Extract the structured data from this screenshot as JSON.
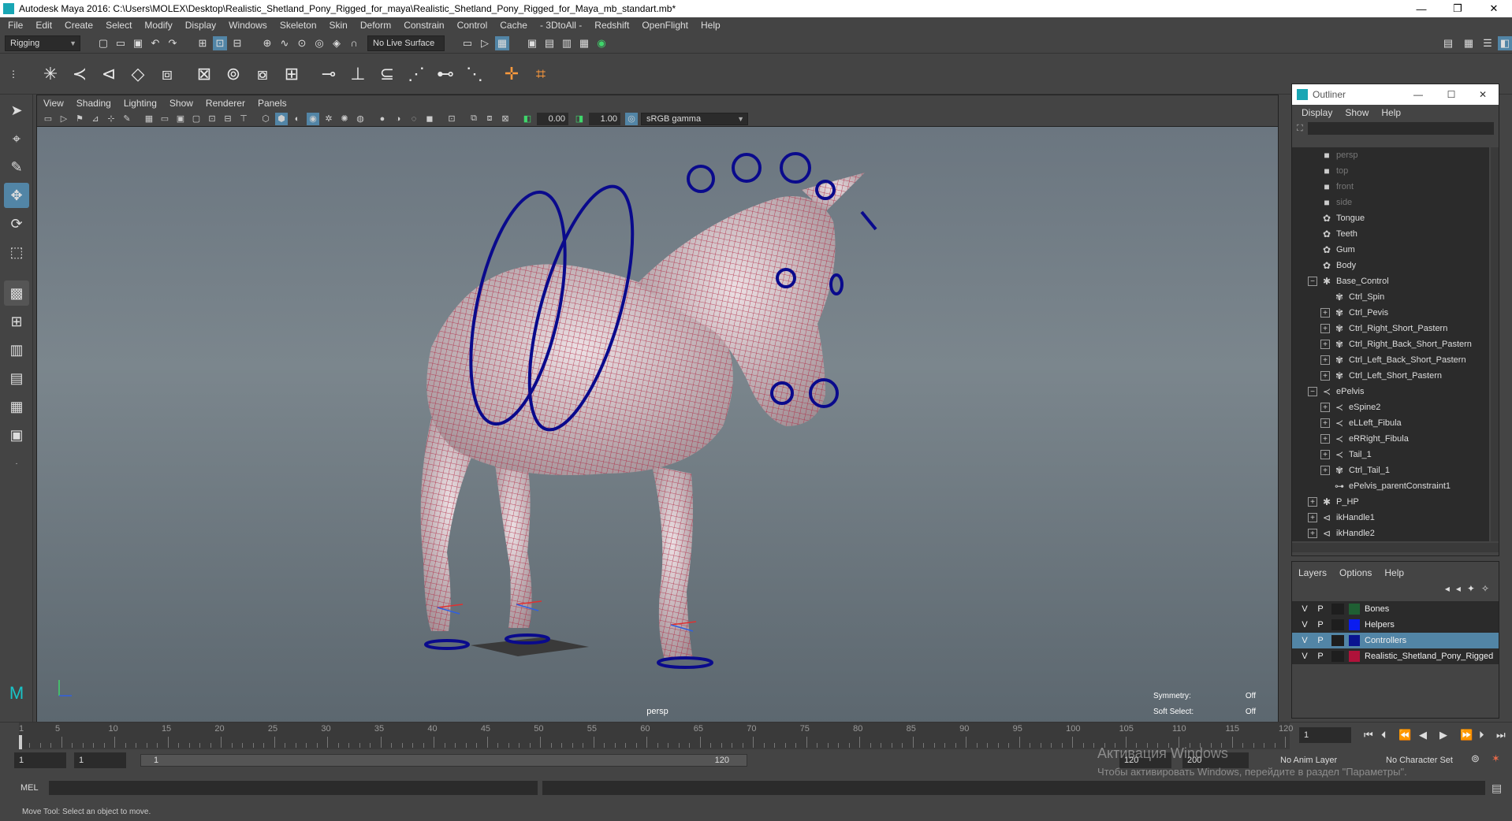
{
  "window": {
    "title": "Autodesk Maya 2016: C:\\Users\\MOLEX\\Desktop\\Realistic_Shetland_Pony_Rigged_for_maya\\Realistic_Shetland_Pony_Rigged_for_Maya_mb_standart.mb*",
    "minimize": "—",
    "restore": "❐",
    "close": "✕"
  },
  "menubar": [
    "File",
    "Edit",
    "Create",
    "Select",
    "Modify",
    "Display",
    "Windows",
    "Skeleton",
    "Skin",
    "Deform",
    "Constrain",
    "Control",
    "Cache",
    "- 3DtoAll -",
    "Redshift",
    "OpenFlight",
    "Help"
  ],
  "statusline": {
    "menuset": "Rigging",
    "live_surface": "No Live Surface"
  },
  "viewport": {
    "menu": [
      "View",
      "Shading",
      "Lighting",
      "Show",
      "Renderer",
      "Panels"
    ],
    "exposure": "0.00",
    "gamma": "1.00",
    "color_space": "sRGB gamma",
    "camera_label": "persp",
    "symmetry_label": "Symmetry:",
    "symmetry_value": "Off",
    "soft_select_label": "Soft Select:",
    "soft_select_value": "Off",
    "accent": "#5285a6",
    "mesh_color": "#b0243f",
    "controller_color": "#0a0a8c"
  },
  "outliner": {
    "title": "Outliner",
    "minimize": "—",
    "maximize": "☐",
    "close": "✕",
    "menu": [
      "Display",
      "Show",
      "Help"
    ],
    "items": [
      {
        "label": "persp",
        "depth": 0,
        "expand": "",
        "icon": "camera",
        "dim": true
      },
      {
        "label": "top",
        "depth": 0,
        "expand": "",
        "icon": "camera",
        "dim": true
      },
      {
        "label": "front",
        "depth": 0,
        "expand": "",
        "icon": "camera",
        "dim": true
      },
      {
        "label": "side",
        "depth": 0,
        "expand": "",
        "icon": "camera",
        "dim": true
      },
      {
        "label": "Tongue",
        "depth": 0,
        "expand": "",
        "icon": "mesh",
        "dim": false
      },
      {
        "label": "Teeth",
        "depth": 0,
        "expand": "",
        "icon": "mesh",
        "dim": false
      },
      {
        "label": "Gum",
        "depth": 0,
        "expand": "",
        "icon": "mesh",
        "dim": false
      },
      {
        "label": "Body",
        "depth": 0,
        "expand": "",
        "icon": "mesh",
        "dim": false
      },
      {
        "label": "Base_Control",
        "depth": 0,
        "expand": "−",
        "icon": "star",
        "dim": false
      },
      {
        "label": "Ctrl_Spin",
        "depth": 1,
        "expand": "",
        "icon": "curve",
        "dim": false
      },
      {
        "label": "Ctrl_Pevis",
        "depth": 1,
        "expand": "+",
        "icon": "curve",
        "dim": false
      },
      {
        "label": "Ctrl_Right_Short_Pastern",
        "depth": 1,
        "expand": "+",
        "icon": "curve",
        "dim": false
      },
      {
        "label": "Ctrl_Right_Back_Short_Pastern",
        "depth": 1,
        "expand": "+",
        "icon": "curve",
        "dim": false
      },
      {
        "label": "Ctrl_Left_Back_Short_Pastern",
        "depth": 1,
        "expand": "+",
        "icon": "curve",
        "dim": false
      },
      {
        "label": "Ctrl_Left_Short_Pastern",
        "depth": 1,
        "expand": "+",
        "icon": "curve",
        "dim": false
      },
      {
        "label": "ePelvis",
        "depth": 0,
        "expand": "−",
        "icon": "joint",
        "dim": false
      },
      {
        "label": "eSpine2",
        "depth": 1,
        "expand": "+",
        "icon": "joint",
        "dim": false
      },
      {
        "label": "eLLeft_Fibula",
        "depth": 1,
        "expand": "+",
        "icon": "joint",
        "dim": false
      },
      {
        "label": "eRRight_Fibula",
        "depth": 1,
        "expand": "+",
        "icon": "joint",
        "dim": false
      },
      {
        "label": "Tail_1",
        "depth": 1,
        "expand": "+",
        "icon": "joint",
        "dim": false
      },
      {
        "label": "Ctrl_Tail_1",
        "depth": 1,
        "expand": "+",
        "icon": "curve",
        "dim": false
      },
      {
        "label": "ePelvis_parentConstraint1",
        "depth": 1,
        "expand": "",
        "icon": "constraint",
        "dim": false
      },
      {
        "label": "P_HP",
        "depth": 0,
        "expand": "+",
        "icon": "star",
        "dim": false
      },
      {
        "label": "ikHandle1",
        "depth": 0,
        "expand": "+",
        "icon": "ik",
        "dim": false
      },
      {
        "label": "ikHandle2",
        "depth": 0,
        "expand": "+",
        "icon": "ik",
        "dim": false
      }
    ]
  },
  "layers": {
    "menu": [
      "Layers",
      "Options",
      "Help"
    ],
    "rows": [
      {
        "v": "V",
        "p": "P",
        "color": "#1f5f33",
        "name": "Bones",
        "selected": false
      },
      {
        "v": "V",
        "p": "P",
        "color": "#0a1cf0",
        "name": "Helpers",
        "selected": false
      },
      {
        "v": "V",
        "p": "P",
        "color": "#0a1490",
        "name": "Controllers",
        "selected": true
      },
      {
        "v": "V",
        "p": "P",
        "color": "#b0123a",
        "name": "Realistic_Shetland_Pony_Rigged",
        "selected": false
      }
    ]
  },
  "timeline": {
    "numbers": [
      "1",
      "5",
      "10",
      "15",
      "20",
      "25",
      "30",
      "35",
      "40",
      "45",
      "50",
      "55",
      "60",
      "65",
      "70",
      "75",
      "80",
      "85",
      "90",
      "95",
      "100",
      "105",
      "110",
      "115",
      "120"
    ],
    "current_frame": "1",
    "range_start": "1",
    "range_playstart": "1",
    "range_bar_start": "1",
    "range_bar_end": "120",
    "range_end": "120",
    "range_max": "200",
    "anim_layer": "No Anim Layer",
    "character_set": "No Character Set"
  },
  "watermark": {
    "line1": "Активация Windows",
    "line2": "Чтобы активировать Windows, перейдите в раздел \"Параметры\"."
  },
  "cmdline": {
    "label": "MEL"
  },
  "helpline": {
    "text": "Move Tool: Select an object to move."
  }
}
